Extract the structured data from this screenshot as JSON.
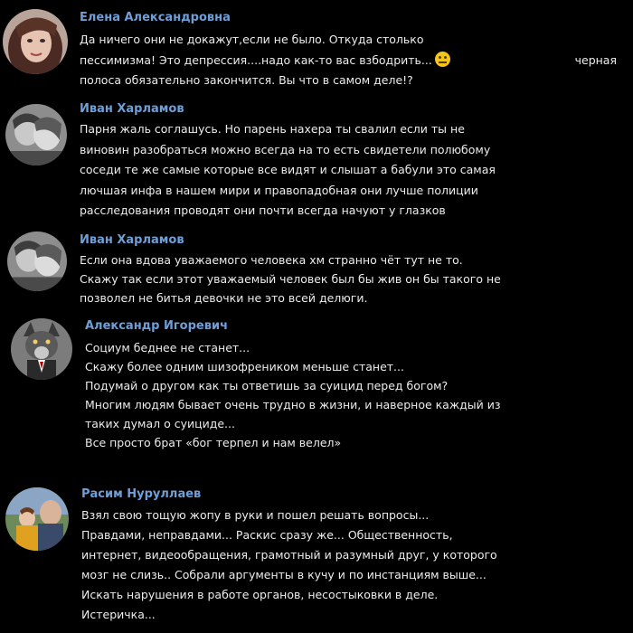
{
  "comments": [
    {
      "author": "Елена Александровна",
      "avatar_icon": "woman-portrait-avatar",
      "lines": [
        "Да ничего они не докажут,если не было. Откуда столько",
        "пессимизма! Это депрессия....надо как-то вас взбодрить...",
        "полоса обязательно закончится. Вы что в самом деле!?"
      ],
      "line2_suffix": "черная",
      "emoji_icon": "neutral-face-emoji"
    },
    {
      "author": "Иван Харламов",
      "avatar_icon": "couple-photo-avatar",
      "lines": [
        "Парня жаль соглашусь. Но парень нахера ты свалил если ты не",
        "виновин разобраться можно всегда на то есть свидетели полюбому",
        "соседи те же самые которые все видят и слышат а бабули это самая",
        "лючшая инфа в нашем мири и правопадобная они лучше полиции",
        "расследования проводят они почти всегда начуют у глазков"
      ]
    },
    {
      "author": "Иван Харламов",
      "avatar_icon": "couple-photo-avatar",
      "lines": [
        "Если она вдова уважаемого человека хм странно чёт тут не то.",
        "Скажу так если этот уважаемый человек был бы жив он бы такого не",
        "позволел не битья девочки не это всей делюги."
      ]
    },
    {
      "author": "Александр Игоревич",
      "avatar_icon": "wolf-in-suit-avatar",
      "lines": [
        "Социум беднее не станет...",
        "Скажу более одним шизофреником меньше станет...",
        "Подумай о другом как ты ответишь за суицид перед богом?",
        "Многим людям бывает очень трудно в жизни, и наверное каждый из",
        "таких думал о суициде...",
        "Все просто брат «бог терпел и нам велел»"
      ]
    },
    {
      "author": "Расим Нуруллаев",
      "avatar_icon": "family-photo-avatar",
      "lines": [
        "Взял свою тощую жопу в руки и пошел решать вопросы...",
        "Правдами, неправдами... Раскис сразу же... Общественность,",
        "интернет, видеообращения, грамотный и разумный друг, у которого",
        "мозг не слизь.. Собрали аргументы в кучу и по инстанциям выше...",
        "Искать нарушения в работе органов, несостыковки в деле.",
        "Истеричка..."
      ]
    }
  ]
}
